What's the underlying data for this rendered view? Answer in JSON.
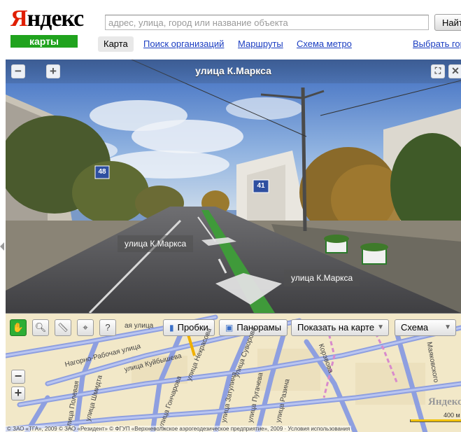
{
  "header": {
    "logo_text_first": "Я",
    "logo_text_rest": "ндекс",
    "logo_sub": "карты",
    "search_placeholder": "адрес, улица, город или название объекта",
    "search_button": "Найти"
  },
  "nav": {
    "tabs": [
      {
        "label": "Карта",
        "active": true
      },
      {
        "label": "Поиск организаций",
        "active": false
      },
      {
        "label": "Маршруты",
        "active": false
      },
      {
        "label": "Схема метро",
        "active": false
      }
    ],
    "select_city": "Выбрать город"
  },
  "panorama": {
    "title": "улица К.Маркса",
    "zoom_out": "−",
    "zoom_in": "+",
    "street_label_1": "улица К.Маркса",
    "street_label_2": "улица К.Маркса",
    "house_number_1": "48",
    "house_number_2": "41"
  },
  "map": {
    "tools": [
      "hand-icon",
      "magnifier-icon",
      "ruler-icon",
      "marker-icon",
      "help-icon"
    ],
    "traffic_button": "Пробки",
    "panoramas_button": "Панорамы",
    "show_on_map": "Показать на карте",
    "map_type": "Схема",
    "zoom_out": "−",
    "zoom_in": "+",
    "road_labels": [
      "ая улица",
      "Нагорно-Рабочая улица",
      "улица Куйбышева",
      "улица Шмидта",
      "улица Полевая",
      "улица Гончарова",
      "улица Затулина",
      "улица Пугачева",
      "улица Разина",
      "улица Суворова",
      "улица Некрасова",
      "Маяковского",
      "Корэвова"
    ],
    "logo": "Яндекс",
    "scale_label": "400 м",
    "copyright": "© ЗАО «ТГА», 2009 © ЗАО «Резидент» © ФГУП «Верхневолжское аэрогеодезическое предприятие», 2009 · Условия использования"
  },
  "colors": {
    "logo_red": "#e01e00",
    "logo_green": "#20a31e",
    "link_blue": "#1a3dc1",
    "map_road": "#7a8ed8",
    "map_bg": "#f2e8c8"
  }
}
